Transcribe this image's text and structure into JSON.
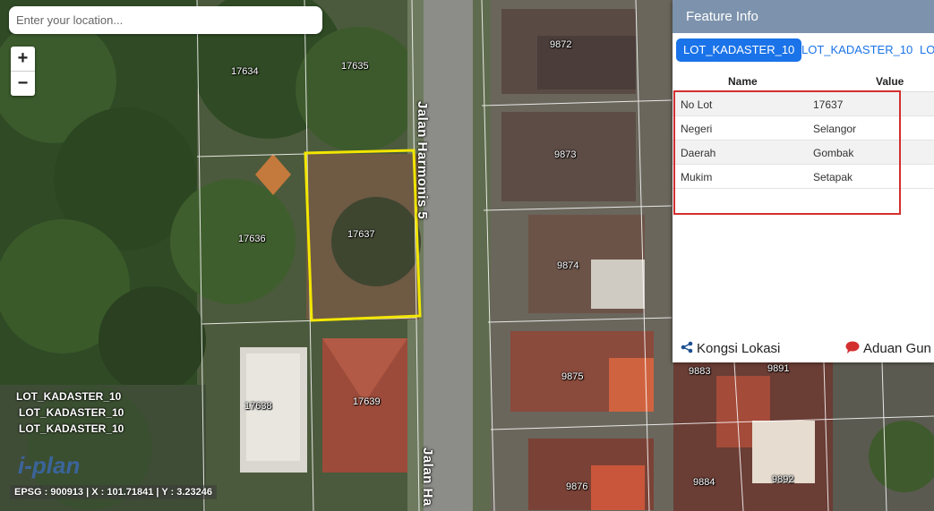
{
  "search": {
    "placeholder": "Enter your location..."
  },
  "zoom": {
    "in_label": "+",
    "out_label": "−"
  },
  "map": {
    "highlight_color": "#f2e600",
    "roads": [
      "Jalan Harmonis 5",
      "Jalan Ha"
    ],
    "lots": [
      "17634",
      "17635",
      "17636",
      "17637",
      "17638",
      "17639",
      "9872",
      "9873",
      "9874",
      "9875",
      "9876",
      "9883",
      "9884",
      "9891",
      "9892"
    ]
  },
  "legend": [
    "LOT_KADASTER_10",
    "LOT_KADASTER_10",
    "LOT_KADASTER_10"
  ],
  "coords": "EPSG : 900913 | X : 101.71841 | Y : 3.23246",
  "panel": {
    "title": "Feature Info",
    "tabs": [
      "LOT_KADASTER_10",
      "LOT_KADASTER_10",
      "LO"
    ],
    "columns": {
      "name": "Name",
      "value": "Value"
    },
    "rows": [
      {
        "name": "No Lot",
        "value": "17637"
      },
      {
        "name": "Negeri",
        "value": "Selangor"
      },
      {
        "name": "Daerah",
        "value": "Gombak"
      },
      {
        "name": "Mukim",
        "value": "Setapak"
      }
    ],
    "share_label": "Kongsi Lokasi",
    "report_label": "Aduan Gun",
    "accent": "#1a73e8",
    "selection_border": "#d32f2f"
  }
}
